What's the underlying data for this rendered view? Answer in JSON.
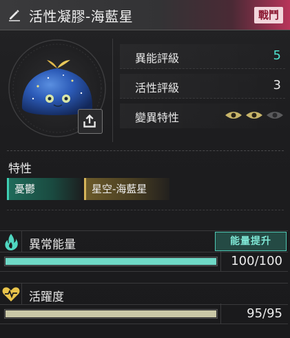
{
  "header": {
    "title": "活性凝膠-海藍星",
    "tag": "戰鬥",
    "accent_color": "#b8345a",
    "edit_icon": "pencil-icon"
  },
  "stats": [
    {
      "label": "異能評級",
      "value": "5",
      "accent": true
    },
    {
      "label": "活性評級",
      "value": "3",
      "accent": false
    },
    {
      "label": "變異特性",
      "eyes": {
        "filled": 2,
        "total": 3
      }
    }
  ],
  "traits": {
    "title": "特性",
    "items": [
      "憂鬱",
      "星空-海藍星"
    ]
  },
  "energy": {
    "label": "異常能量",
    "boost_label": "能量提升",
    "value_text": "100/100",
    "fill_fraction": 1.0,
    "color": "#6fd9c6"
  },
  "activity": {
    "label": "活躍度",
    "value_text": "95/95",
    "fill_fraction": 1.0,
    "color": "#c9c7a6"
  }
}
